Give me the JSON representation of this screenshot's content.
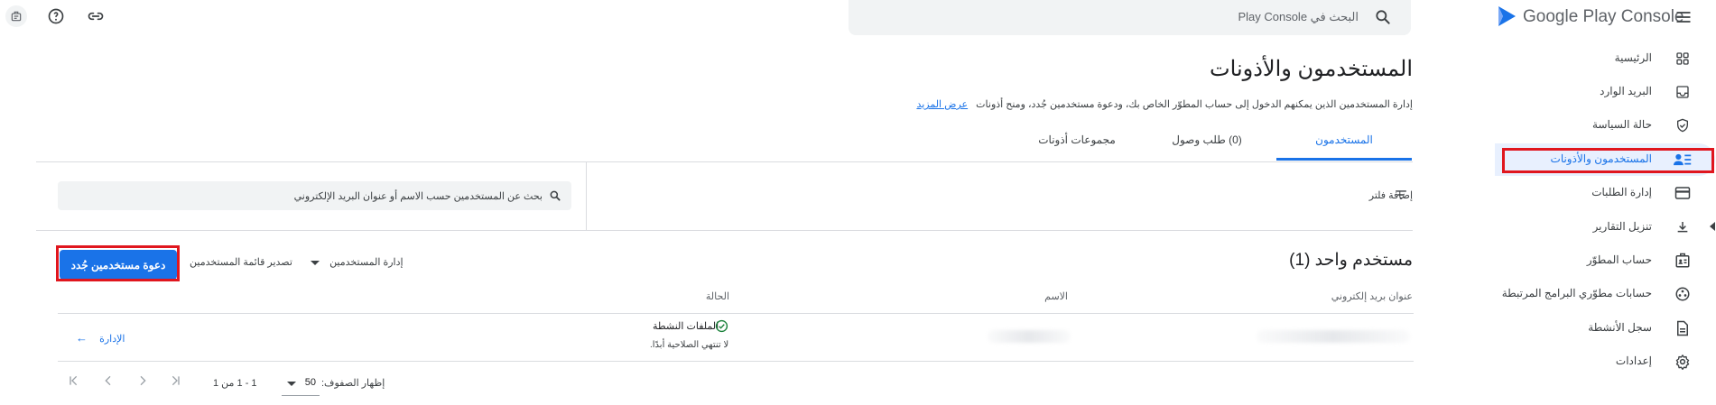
{
  "app": {
    "logo_text": "Google Play Console",
    "brand_color": "#01875f",
    "accent_color": "#1a73e8"
  },
  "topbar": {
    "search_placeholder": "البحث في Play Console"
  },
  "sidebar": {
    "items": [
      {
        "label": "الرئيسية",
        "icon": "grid-icon"
      },
      {
        "label": "البريد الوارد",
        "icon": "inbox-icon"
      },
      {
        "label": "حالة السياسة",
        "icon": "shield-icon"
      },
      {
        "label": "المستخدمون والأذونات",
        "icon": "users-permissions-icon",
        "active": true
      },
      {
        "label": "إدارة الطلبات",
        "icon": "credit-card-icon"
      },
      {
        "label": "تنزيل التقارير",
        "icon": "download-icon"
      },
      {
        "label": "حساب المطوّر",
        "icon": "id-card-icon"
      },
      {
        "label": "حسابات مطوّري البرامج المرتبطة",
        "icon": "linked-accounts-icon"
      },
      {
        "label": "سجل الأنشطة",
        "icon": "document-icon"
      },
      {
        "label": "إعدادات",
        "icon": "gear-icon"
      }
    ]
  },
  "page": {
    "title": "المستخدمون والأذونات",
    "subtitle": "إدارة المستخدمين الذين يمكنهم الدخول إلى حساب المطوّر الخاص بك، ودعوة مستخدمين جُدد، ومنح أذونات",
    "learn_more": "عرض المزيد",
    "tabs": [
      "المستخدمون",
      "(0) طلب وصول",
      "مجموعات أذونات"
    ],
    "add_filter": "إضافة فلتر",
    "search_placeholder": "بحث عن المستخدمين حسب الاسم أو عنوان البريد الإلكتروني",
    "count_title": "مستخدم واحد (1)",
    "manage_users": "إدارة المستخدمين",
    "export_users": "تصدير قائمة المستخدمين",
    "invite_button": "دعوة مستخدمين جُدد"
  },
  "table": {
    "headers": {
      "email": "عنوان بريد إلكتروني",
      "name": "الاسم",
      "status": "الحالة"
    },
    "rows": [
      {
        "status": "الملفات النشطة",
        "status_sub": "لا تنتهي الصلاحية أبدًا.",
        "action": "الإدارة"
      }
    ]
  },
  "pagination": {
    "rows_label": "إظهار الصفوف:",
    "rows_value": "50",
    "range": "1 - 1 من 1"
  }
}
